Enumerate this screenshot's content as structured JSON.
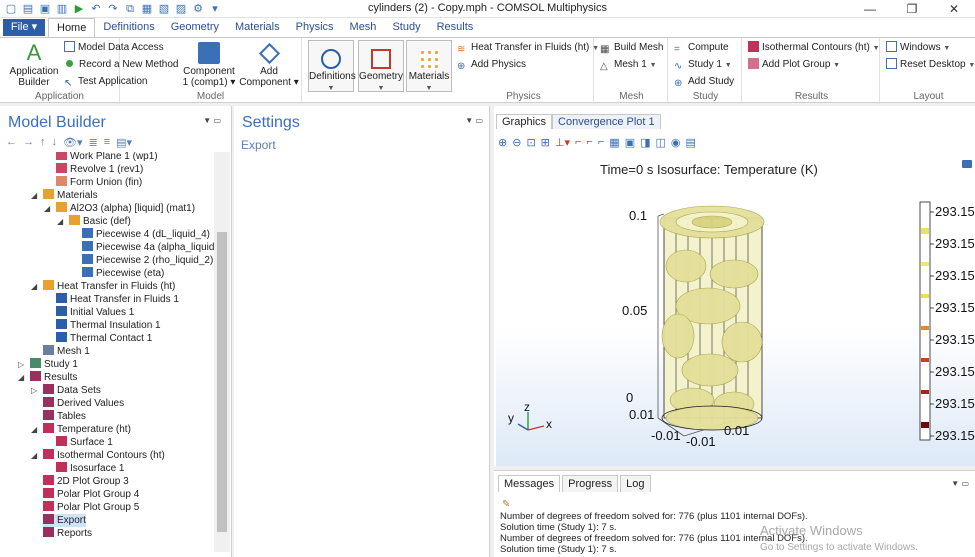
{
  "window": {
    "title": "cylinders (2) - Copy.mph - COMSOL Multiphysics",
    "controls": [
      "—",
      "❐",
      "✕"
    ]
  },
  "ribbon_tabs": {
    "file": "File ▾",
    "tabs": [
      "Home",
      "Definitions",
      "Geometry",
      "Materials",
      "Physics",
      "Mesh",
      "Study",
      "Results"
    ]
  },
  "ribbon": {
    "application": {
      "builder_line1": "Application",
      "builder_line2": "Builder",
      "model_data_access": "Model Data Access",
      "record_method": "Record a New Method",
      "test_app": "Test Application",
      "label": "Application"
    },
    "model": {
      "component_line1": "Component",
      "component_line2": "1 (comp1) ▾",
      "add_component_line1": "Add",
      "add_component_line2": "Component ▾",
      "label": "Model"
    },
    "definitions": "Definitions",
    "geometry": "Geometry",
    "materials": "Materials",
    "physics": {
      "htf": "Heat Transfer in Fluids (ht)",
      "add_physics": "Add Physics",
      "label": "Physics"
    },
    "mesh": {
      "build": "Build Mesh",
      "mesh1": "Mesh 1",
      "label": "Mesh"
    },
    "study": {
      "compute": "Compute",
      "study1": "Study 1",
      "add_study": "Add Study",
      "label": "Study"
    },
    "results": {
      "iso": "Isothermal Contours (ht)",
      "add_plot": "Add Plot Group",
      "label": "Results"
    },
    "layout": {
      "windows": "Windows",
      "reset": "Reset Desktop",
      "label": "Layout"
    }
  },
  "model_builder": {
    "title": "Model Builder",
    "tree": [
      {
        "label": "Work Plane 1 (wp1)",
        "indent": 4,
        "icon": "#c46",
        "exp": ""
      },
      {
        "label": "Revolve 1 (rev1)",
        "indent": 4,
        "icon": "#c46",
        "exp": ""
      },
      {
        "label": "Form Union (fin)",
        "indent": 4,
        "icon": "#d86",
        "exp": ""
      },
      {
        "label": "Materials",
        "indent": 3,
        "icon": "#e8a030",
        "exp": "◢"
      },
      {
        "label": "Al2O3 (alpha) [liquid] (mat1)",
        "indent": 4,
        "icon": "#e8a030",
        "exp": "◢"
      },
      {
        "label": "Basic (def)",
        "indent": 5,
        "icon": "#e8a030",
        "exp": "◢"
      },
      {
        "label": "Piecewise 4 (dL_liquid_4)",
        "indent": 6,
        "icon": "#3b6fb6",
        "exp": ""
      },
      {
        "label": "Piecewise 4a (alpha_liquid)",
        "indent": 6,
        "icon": "#3b6fb6",
        "exp": ""
      },
      {
        "label": "Piecewise 2 (rho_liquid_2)",
        "indent": 6,
        "icon": "#3b6fb6",
        "exp": ""
      },
      {
        "label": "Piecewise (eta)",
        "indent": 6,
        "icon": "#3b6fb6",
        "exp": ""
      },
      {
        "label": "Heat Transfer in Fluids (ht)",
        "indent": 3,
        "icon": "#e8a030",
        "exp": "◢"
      },
      {
        "label": "Heat Transfer in Fluids 1",
        "indent": 4,
        "icon": "#2a5ea8",
        "exp": ""
      },
      {
        "label": "Initial Values 1",
        "indent": 4,
        "icon": "#2a5ea8",
        "exp": ""
      },
      {
        "label": "Thermal Insulation 1",
        "indent": 4,
        "icon": "#2a5ea8",
        "exp": ""
      },
      {
        "label": "Thermal Contact 1",
        "indent": 4,
        "icon": "#2a5ea8",
        "exp": ""
      },
      {
        "label": "Mesh 1",
        "indent": 3,
        "icon": "#6a7fa0",
        "exp": ""
      },
      {
        "label": "Study 1",
        "indent": 2,
        "icon": "#4a8a6a",
        "exp": "▷"
      },
      {
        "label": "Results",
        "indent": 2,
        "icon": "#9a3060",
        "exp": "◢"
      },
      {
        "label": "Data Sets",
        "indent": 3,
        "icon": "#9a3060",
        "exp": "▷"
      },
      {
        "label": "Derived Values",
        "indent": 3,
        "icon": "#9a3060",
        "exp": ""
      },
      {
        "label": "Tables",
        "indent": 3,
        "icon": "#9a3060",
        "exp": ""
      },
      {
        "label": "Temperature (ht)",
        "indent": 3,
        "icon": "#c0305a",
        "exp": "◢"
      },
      {
        "label": "Surface 1",
        "indent": 4,
        "icon": "#c0305a",
        "exp": ""
      },
      {
        "label": "Isothermal Contours (ht)",
        "indent": 3,
        "icon": "#c0305a",
        "exp": "◢"
      },
      {
        "label": "Isosurface 1",
        "indent": 4,
        "icon": "#c0305a",
        "exp": ""
      },
      {
        "label": "2D Plot Group 3",
        "indent": 3,
        "icon": "#c0305a",
        "exp": ""
      },
      {
        "label": "Polar Plot Group 4",
        "indent": 3,
        "icon": "#c0305a",
        "exp": ""
      },
      {
        "label": "Polar Plot Group 5",
        "indent": 3,
        "icon": "#c0305a",
        "exp": ""
      },
      {
        "label": "Export",
        "indent": 3,
        "icon": "#9a3060",
        "exp": "",
        "selected": true
      },
      {
        "label": "Reports",
        "indent": 3,
        "icon": "#9a3060",
        "exp": ""
      }
    ]
  },
  "settings": {
    "title": "Settings",
    "subtitle": "Export"
  },
  "graphics": {
    "tabs": [
      "Graphics",
      "Convergence Plot 1"
    ],
    "plot_title": "Time=0 s   Isosurface: Temperature (K)",
    "axis_labels": [
      "0.1",
      "0.05",
      "0",
      "0.01",
      "-0.01",
      "-0.01",
      "0.01"
    ],
    "triad": {
      "x": "x",
      "y": "y",
      "z": "z"
    },
    "legend_ticks": [
      "293.15",
      "293.15",
      "293.15",
      "293.15",
      "293.15",
      "293.15",
      "293.15",
      "293.15"
    ],
    "colors": {
      "iso": "#e8e6a0",
      "iso_dark": "#b9b45a",
      "legend_hot": "#8b0000",
      "legend_mid": "#ff7f00",
      "legend_cold": "#ffffe0"
    }
  },
  "messages": {
    "tabs": [
      "Messages",
      "Progress",
      "Log"
    ],
    "lines": [
      "Number of degrees of freedom solved for: 776 (plus 1101 internal DOFs).",
      "Solution time (Study 1): 7 s.",
      "Number of degrees of freedom solved for: 776 (plus 1101 internal DOFs).",
      "Solution time (Study 1): 7 s."
    ],
    "watermark_title": "Activate Windows",
    "watermark_sub": "Go to Settings to activate Windows."
  }
}
